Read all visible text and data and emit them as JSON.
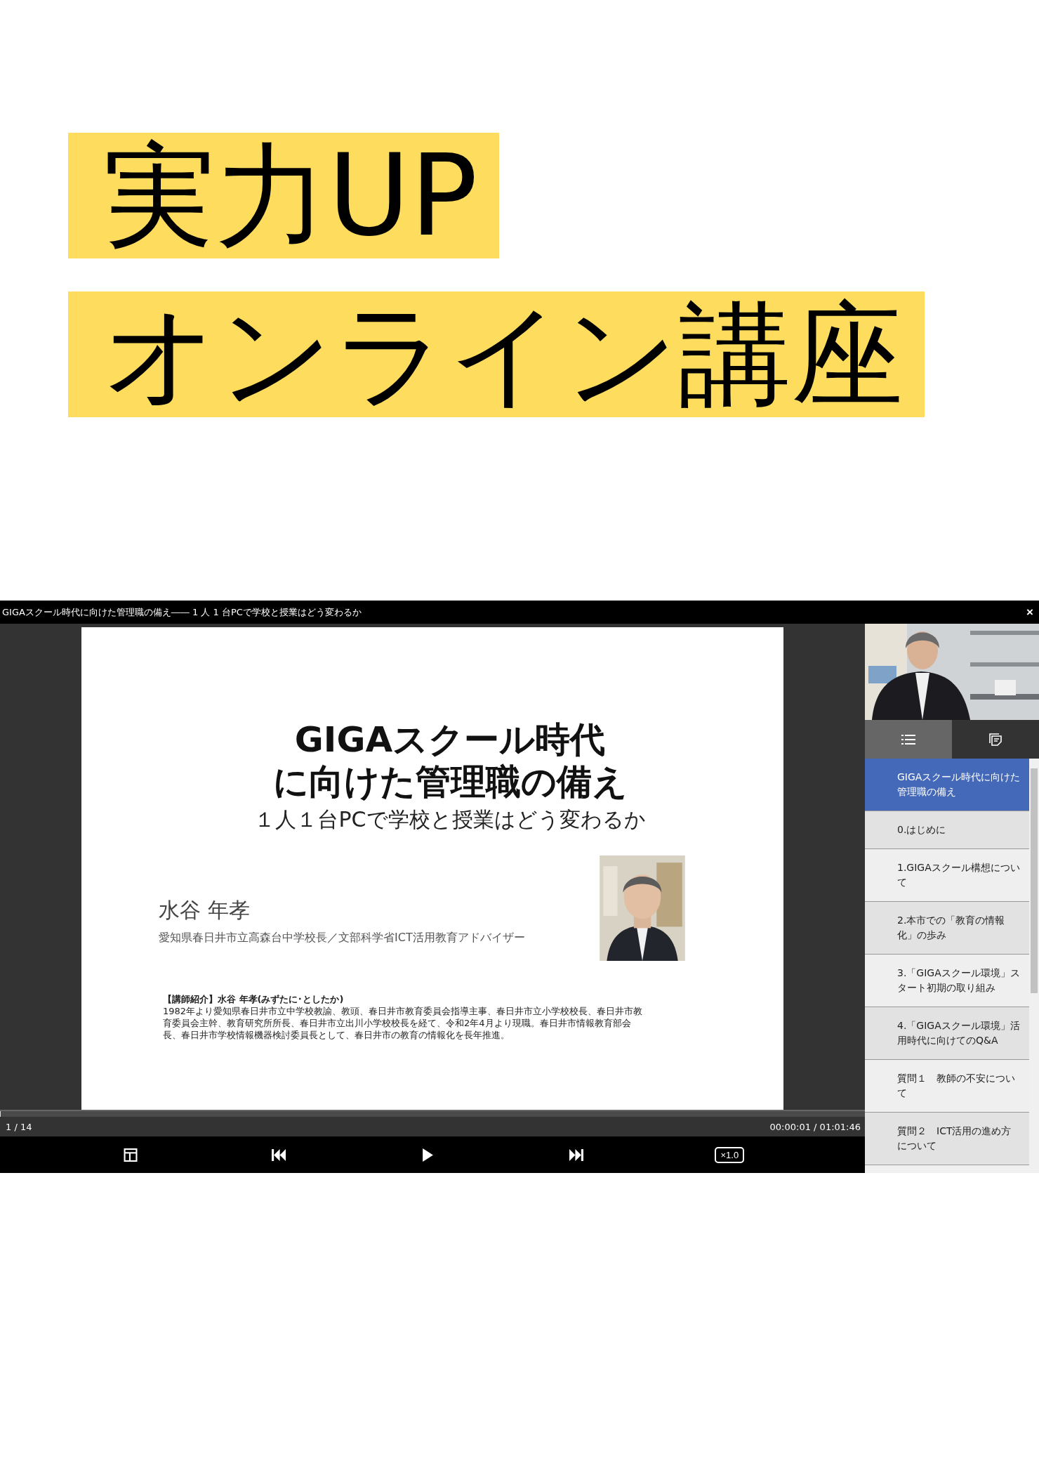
{
  "banners": [
    "実力UP",
    "オンライン講座"
  ],
  "player": {
    "title": "GIGAスクール時代に向けた管理職の備え―― 1 人 1 台PCで学校と授業はどう変わるか",
    "close": "×",
    "slide": {
      "title_lines": [
        "GIGAスクール時代",
        "に向けた管理職の備え"
      ],
      "subtitle": "１人１台PCで学校と授業はどう変わるか",
      "speaker": "水谷 年孝",
      "affiliation": "愛知県春日井市立高森台中学校長／文部科学省ICT活用教育アドバイザー",
      "profile": "**【講師紹介】水谷 年孝(みずたに･としたか)**\n1982年より愛知県春日井市立中学校教諭、教頭、春日井市教育委員会指導主事、春日井市立小学校校長、春日井市教育委員会主幹、教育研究所所長、春日井市立出川小学校校長を経て、令和2年4月より現職。春日井市情報教育部会長、春日井市学校情報機器検討委員長として、春日井市の教育の情報化を長年推進。"
    },
    "seek": {
      "level": 0.0003
    },
    "page": "1 / 14",
    "time": "00:00:01 / 01:01:46",
    "speed": "×1.0",
    "tabs": [
      {
        "kind": "list",
        "selected": true
      },
      {
        "kind": "notes",
        "selected": false
      }
    ],
    "chapters": [
      {
        "label": "GIGAスクール時代に向けた管理職の備え",
        "selected": true
      },
      {
        "label": "0.はじめに",
        "selected": false
      },
      {
        "label": "1.GIGAスクール構想について",
        "selected": false
      },
      {
        "label": "2.本市での「教育の情報化」の歩み",
        "selected": false
      },
      {
        "label": "3.「GIGAスクール環境」スタート初期の取り組み",
        "selected": false
      },
      {
        "label": "4.「GIGAスクール環境」活用時代に向けてのQ&A",
        "selected": false
      },
      {
        "label": "質問１　教師の不安について",
        "selected": false
      },
      {
        "label": "質問２　ICT活用の進め方について",
        "selected": false
      }
    ]
  }
}
